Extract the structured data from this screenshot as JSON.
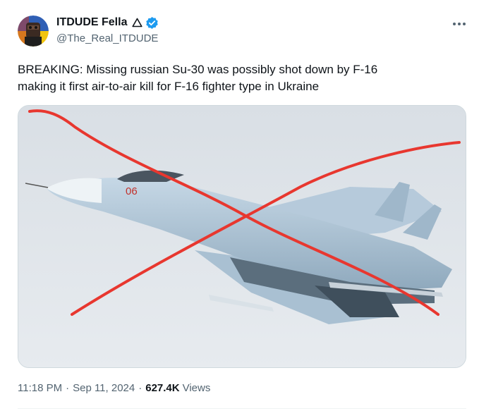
{
  "author": {
    "display_name": "ITDUDE Fella",
    "handle": "@The_Real_ITDUDE",
    "verified": true,
    "name_emoji_icon": "warning-triangle-icon",
    "avatar_icon": "avatar-image"
  },
  "tweet": {
    "lines": [
      "BREAKING: Missing russian Su-30 was possibly shot down by F-16",
      "making it first air-to-air kill for F-16 fighter type in Ukraine"
    ],
    "media": {
      "description_icon": "fighter-jet-photo",
      "aircraft_marking": "06",
      "overlay_color": "#e8372f"
    }
  },
  "meta": {
    "time": "11:18 PM",
    "date": "Sep 11, 2024",
    "separator": "·",
    "views_count": "627.4K",
    "views_label": "Views"
  },
  "colors": {
    "text_primary": "#0f1419",
    "text_secondary": "#536471",
    "verified_blue": "#1d9bf0",
    "border": "#cfd9de"
  }
}
